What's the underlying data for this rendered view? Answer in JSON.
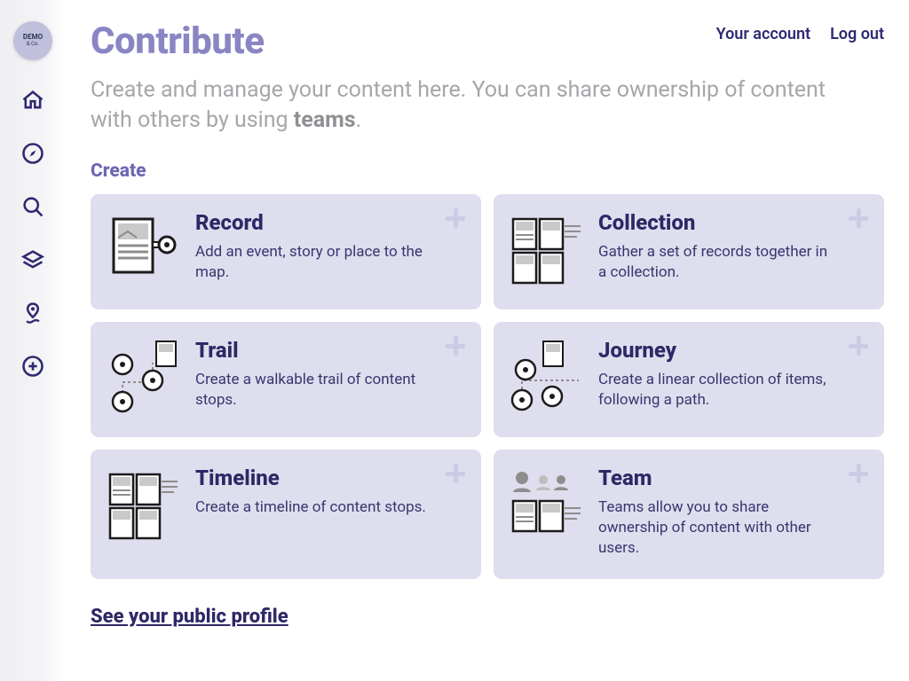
{
  "brand": {
    "line1": "DEMO",
    "line2": "& Co."
  },
  "nav": {
    "account": "Your account",
    "logout": "Log out"
  },
  "sidebarIcons": [
    "home",
    "compass",
    "search",
    "layers",
    "pin-route",
    "add-circle"
  ],
  "page": {
    "title": "Contribute",
    "introPrefix": "Create and manage your content here. You can share ownership of content with others by using ",
    "introBold": "teams",
    "introSuffix": "."
  },
  "createHeading": "Create",
  "cards": [
    {
      "key": "record",
      "title": "Record",
      "desc": "Add an event, story or place to the map."
    },
    {
      "key": "collection",
      "title": "Collection",
      "desc": "Gather a set of records together in a collection."
    },
    {
      "key": "trail",
      "title": "Trail",
      "desc": "Create a walkable trail of content stops."
    },
    {
      "key": "journey",
      "title": "Journey",
      "desc": "Create a linear collection of items, following a path."
    },
    {
      "key": "timeline",
      "title": "Timeline",
      "desc": "Create a timeline of content stops."
    },
    {
      "key": "team",
      "title": "Team",
      "desc": "Teams allow you to share ownership of content with other users."
    }
  ],
  "profileLink": "See your public profile"
}
